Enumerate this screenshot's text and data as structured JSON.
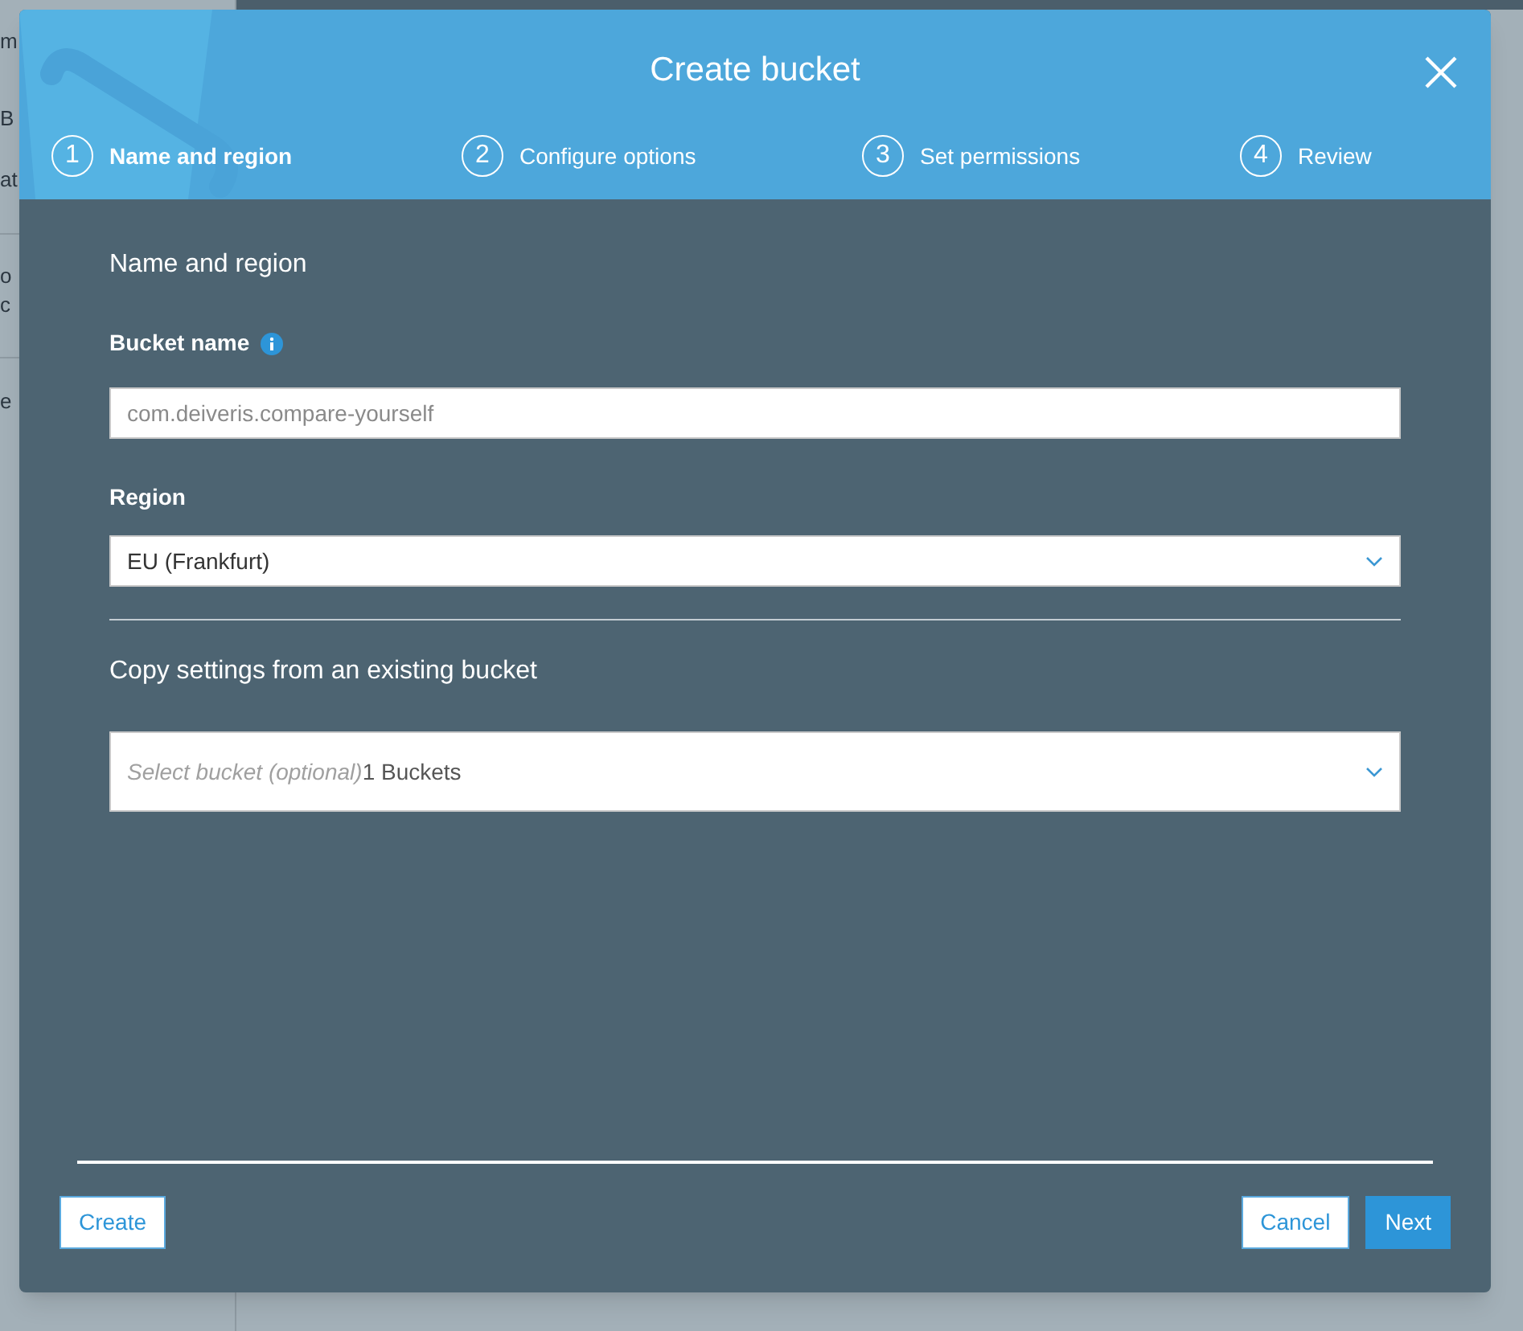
{
  "background_sidebar": {
    "fragments": [
      "m",
      "B",
      "at",
      "o",
      "c",
      "e"
    ]
  },
  "dialog": {
    "title": "Create bucket",
    "steps": [
      {
        "number": "1",
        "label": "Name and region",
        "selected": true
      },
      {
        "number": "2",
        "label": "Configure options",
        "selected": false
      },
      {
        "number": "3",
        "label": "Set permissions",
        "selected": false
      },
      {
        "number": "4",
        "label": "Review",
        "selected": false
      }
    ],
    "section_title": "Name and region",
    "bucket_name": {
      "label": "Bucket name",
      "placeholder": "com.deiveris.compare-yourself"
    },
    "region": {
      "label": "Region",
      "value": "EU (Frankfurt)"
    },
    "copy_settings": {
      "title": "Copy settings from an existing bucket",
      "placeholder": "Select bucket (optional)",
      "count": "1 Buckets"
    },
    "buttons": [
      {
        "label": "Create",
        "kind": "secondary"
      },
      {
        "label": "Cancel",
        "kind": "secondary"
      },
      {
        "label": "Next",
        "kind": "primary"
      }
    ]
  }
}
